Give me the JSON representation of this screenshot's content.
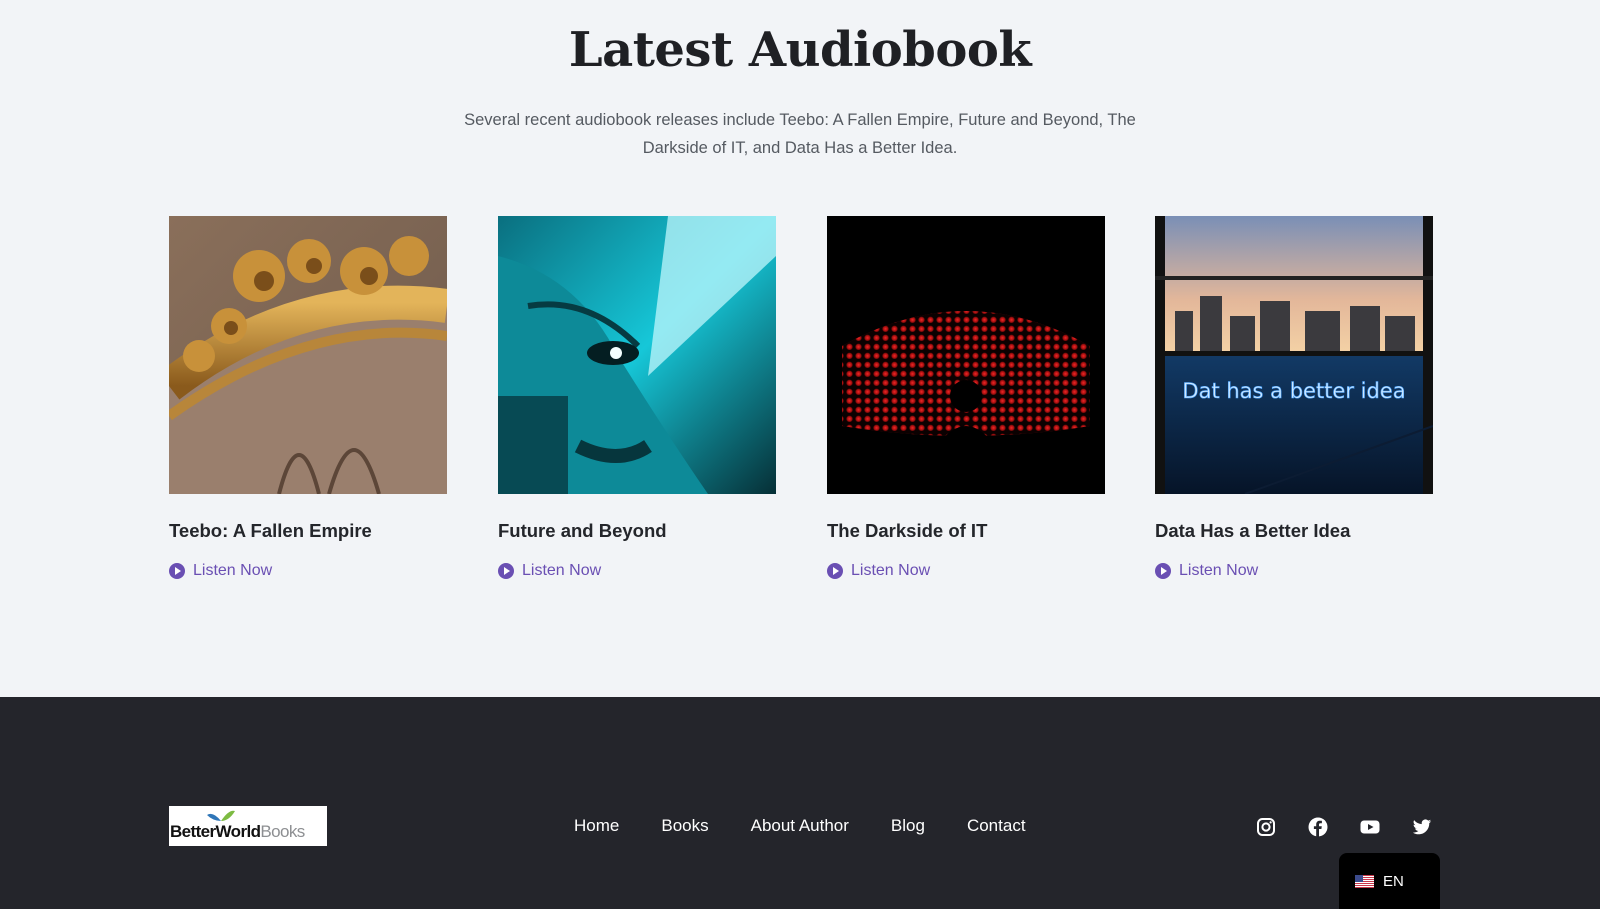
{
  "section": {
    "title": "Latest Audiobook",
    "subtitle": "Several recent audiobook releases include Teebo: A Fallen Empire, Future and Beyond, The Darkside of IT, and Data Has a Better Idea."
  },
  "books": [
    {
      "title": "Teebo: A Fallen Empire",
      "cta": "Listen Now",
      "image": "ornate-gold-frame"
    },
    {
      "title": "Future and Beyond",
      "cta": "Listen Now",
      "image": "cyan-face-closeup"
    },
    {
      "title": "The Darkside of IT",
      "cta": "Listen Now",
      "image": "red-led-wall-silhouette"
    },
    {
      "title": "Data Has a Better Idea",
      "cta": "Listen Now",
      "image": "neon-sign-city-window",
      "sign_text": "Dat  has a better idea"
    }
  ],
  "footer": {
    "logo_bold": "BetterWorld",
    "logo_light": "Books",
    "nav": [
      "Home",
      "Books",
      "About Author",
      "Blog",
      "Contact"
    ],
    "social_icons": [
      "instagram-icon",
      "facebook-icon",
      "youtube-icon",
      "twitter-icon"
    ],
    "language": "EN"
  },
  "colors": {
    "accent": "#6a4fb3",
    "footer_bg": "#24252b",
    "page_bg": "#f2f4f7"
  }
}
